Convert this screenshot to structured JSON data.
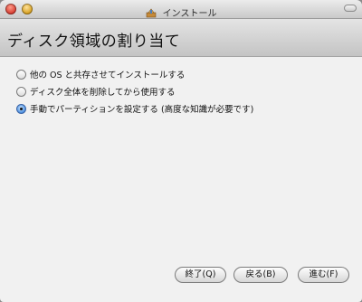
{
  "window": {
    "title": "インストール",
    "title_icon": "installer-icon"
  },
  "header": {
    "heading": "ディスク領域の割り当て"
  },
  "options": [
    {
      "label": "他の OS と共存させてインストールする",
      "selected": false
    },
    {
      "label": "ディスク全体を削除してから使用する",
      "selected": false
    },
    {
      "label": "手動でパーティションを設定する (高度な知識が必要です)",
      "selected": true
    }
  ],
  "buttons": {
    "quit": "終了(Q)",
    "back": "戻る(B)",
    "next": "進む(F)"
  }
}
